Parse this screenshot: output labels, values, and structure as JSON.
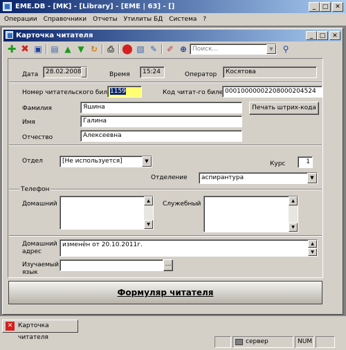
{
  "window": {
    "title": "EME.DB - [MK] - [Library] - [EME | 63] - []"
  },
  "menu": [
    "Операции",
    "Справочники",
    "Отчеты",
    "Утилиты БД",
    "Система",
    "?"
  ],
  "child_window": {
    "title": "Карточка читателя"
  },
  "toolbar": {
    "icons": [
      "add-icon",
      "delete-icon",
      "save-icon",
      "card-icon",
      "arrow-up-icon",
      "arrow-down-icon",
      "refresh-icon",
      "print-icon",
      "stop-icon",
      "document-icon",
      "edit-icon",
      "note-icon",
      "settings-icon",
      "search-icon"
    ],
    "search_placeholder": "Поиск..."
  },
  "header": {
    "date_label": "Дата",
    "date_value": "28.02.2008",
    "time_label": "Время",
    "time_value": "15:24",
    "operator_label": "Оператор",
    "operator_value": "Косятова"
  },
  "reader": {
    "card_number_label": "Номер читательского билета",
    "card_number_value": "1159",
    "code_label": "Код читат-го билета",
    "code_value": "00010000002208000204524",
    "surname_label": "Фамилия",
    "surname_value": "Яшина",
    "name_label": "Имя",
    "name_value": "Галина",
    "patronymic_label": "Отчество",
    "patronymic_value": "Алексеевна",
    "print_barcode_button": "Печать штрих-кода"
  },
  "department": {
    "dept_label": "Отдел",
    "dept_value": "[Не используется]",
    "course_label": "Курс",
    "course_value": "1",
    "branch_label": "Отделение",
    "branch_value": "аспирантура"
  },
  "phone": {
    "group_label": "Телефон",
    "home_label": "Домашний",
    "home_value": "",
    "work_label": "Служебный",
    "work_value": ""
  },
  "address": {
    "home_address_label_1": "Домашний",
    "home_address_label_2": "адрес",
    "home_address_value": "изменён от 20.10.2011г.",
    "language_label_1": "Изучаемый",
    "language_label_2": "язык",
    "language_value": "",
    "language_browse": "..."
  },
  "main_button": "Формуляр читателя",
  "task_tab": "Карточка читателя",
  "statusbar": {
    "server": "сервер",
    "num": "NUM"
  }
}
